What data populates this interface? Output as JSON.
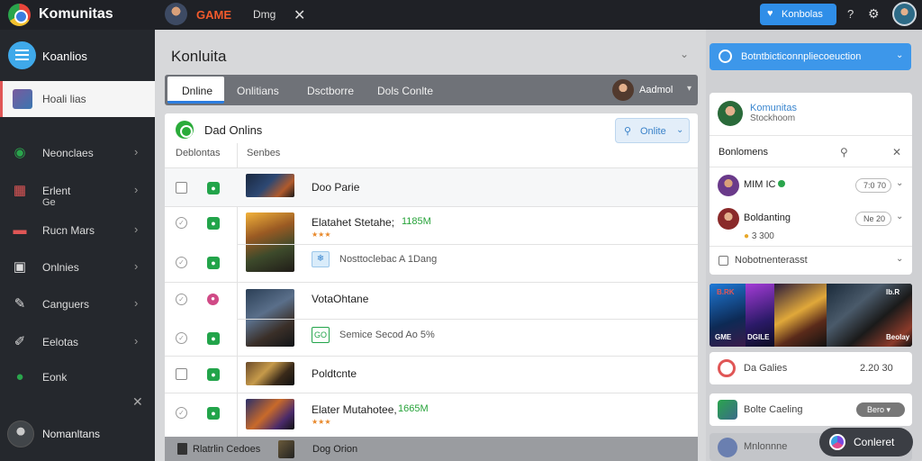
{
  "topbar": {
    "brand": "Komunitas",
    "game_label": "GAME",
    "dmg_label": "Dmg",
    "action_button": "Konbolas",
    "icons": [
      "brand-logo-icon",
      "close-icon",
      "heart-icon",
      "help-icon",
      "gear-icon"
    ]
  },
  "sidebar": {
    "header": "Koanlios",
    "active_item": "Hoali lias",
    "items": [
      {
        "label": "Neonclaes",
        "icon": "chat-icon",
        "icon_color": "#2aa54c"
      },
      {
        "label": "Erlent",
        "sub": "Ge",
        "icon": "game-icon",
        "icon_color": "#e05656"
      },
      {
        "label": "Rucn Mars",
        "icon": "controller-icon",
        "icon_color": "#e05656"
      },
      {
        "label": "Onlnies",
        "icon": "bag-icon",
        "icon_color": "#dddddd"
      },
      {
        "label": "Canguers",
        "icon": "wrench-icon",
        "icon_color": "#dddddd"
      },
      {
        "label": "Eelotas",
        "icon": "brush-icon",
        "icon_color": "#dddddd"
      },
      {
        "label": "Eonk",
        "icon": "circle-icon",
        "icon_color": "#2aa54c"
      }
    ],
    "bottom_user": "Nomanltans"
  },
  "main": {
    "title": "Konluita",
    "tabs": [
      "Dnline",
      "Onlitians",
      "Dsctborre",
      "Dols Conlte"
    ],
    "tab_user": "Aadmol",
    "panel": {
      "title": "Dad Onlins",
      "online_button": "Onlite",
      "col1": "Deblontas",
      "col2": "Senbes"
    },
    "rows": [
      {
        "title": "Doo Parie"
      },
      {
        "title": "Elatahet Stetahe;",
        "tag": "1185M",
        "meta": "Nosttoclebac A 1Dang",
        "chip": "❄"
      },
      {
        "title": "VotaOhtane",
        "meta": "Semice Secod Ao 5%",
        "chip": "GO"
      },
      {
        "title": "Poldtcnte"
      },
      {
        "title": "Elater Mutahotee,",
        "tag": "1665M"
      }
    ],
    "footer": {
      "left": "Rlatrlin Cedoes",
      "right": "Dog Orion"
    }
  },
  "right": {
    "top_button": "Botntbicticonnpliecoeuction",
    "profile": {
      "name": "Komunitas",
      "sub": "Stockhoom"
    },
    "card_title": "Bonlomens",
    "entries": [
      {
        "name": "MIM IC",
        "pill": "7:0 70"
      },
      {
        "name": "Boldanting",
        "pill": "Ne 20",
        "meta": "3 300"
      }
    ],
    "checkbox_label": "Nobotnenterasst",
    "banner_tags": [
      "B.RK",
      "Ib.R",
      "GME",
      "DGILE",
      "Beolay"
    ],
    "item1": {
      "name": "Da Galies",
      "value": "2.20 30"
    },
    "item2": {
      "name": "Bolte Caeling",
      "pill": "Bero"
    },
    "item3": {
      "name": "Mnlonnne"
    },
    "chat_button": "Conleret"
  },
  "colors": {
    "accent": "#2f8ee8",
    "green": "#27a33a",
    "danger": "#e05656",
    "sidebar_bg": "#25282d"
  }
}
